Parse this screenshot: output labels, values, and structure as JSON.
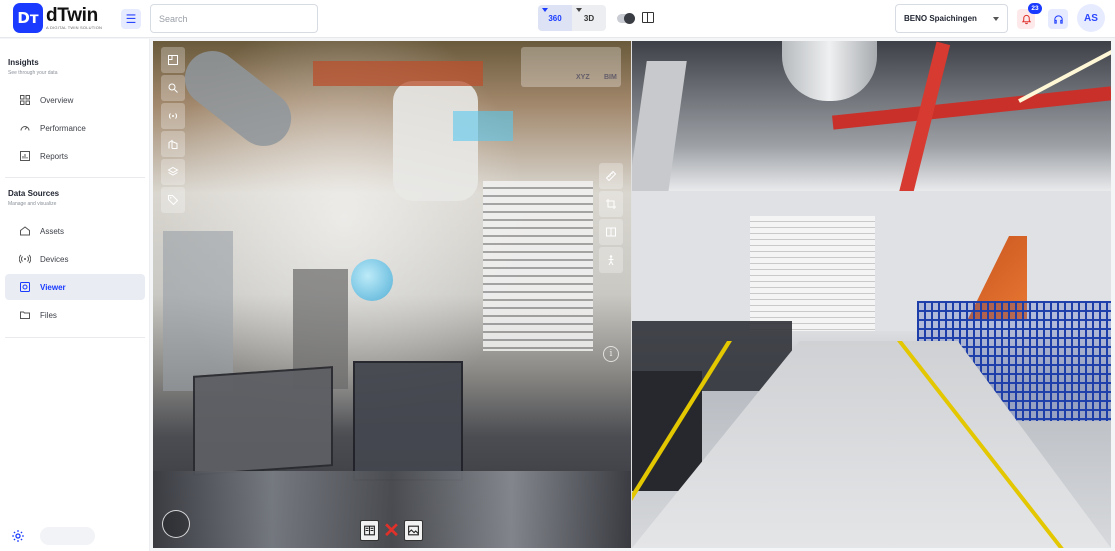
{
  "header": {
    "logo_mark": "Dт",
    "logo_name": "dTwin",
    "logo_tagline": "A DIGITAL TWIN SOLUTION",
    "search_placeholder": "Search",
    "view_modes": [
      {
        "label": "360",
        "active": true
      },
      {
        "label": "3D",
        "active": false
      }
    ],
    "site_select": "BENO Spaichingen",
    "notification_count": "23",
    "avatar_initials": "AS",
    "accent_color": "#1a3bff"
  },
  "sidebar": {
    "sections": [
      {
        "title": "Insights",
        "subtitle": "See through your data",
        "items": [
          {
            "label": "Overview",
            "icon": "grid-icon"
          },
          {
            "label": "Performance",
            "icon": "gauge-icon"
          },
          {
            "label": "Reports",
            "icon": "bar-chart-icon"
          }
        ]
      },
      {
        "title": "Data Sources",
        "subtitle": "Manage and visualize",
        "items": [
          {
            "label": "Assets",
            "icon": "home-icon"
          },
          {
            "label": "Devices",
            "icon": "broadcast-icon"
          },
          {
            "label": "Viewer",
            "icon": "viewer-icon",
            "active": true
          },
          {
            "label": "Files",
            "icon": "folder-icon"
          }
        ]
      }
    ]
  },
  "viewer": {
    "mode_labels": {
      "xyz": "XYZ",
      "bim": "BIM"
    },
    "info_symbol": "i",
    "close_symbol": "✕"
  }
}
